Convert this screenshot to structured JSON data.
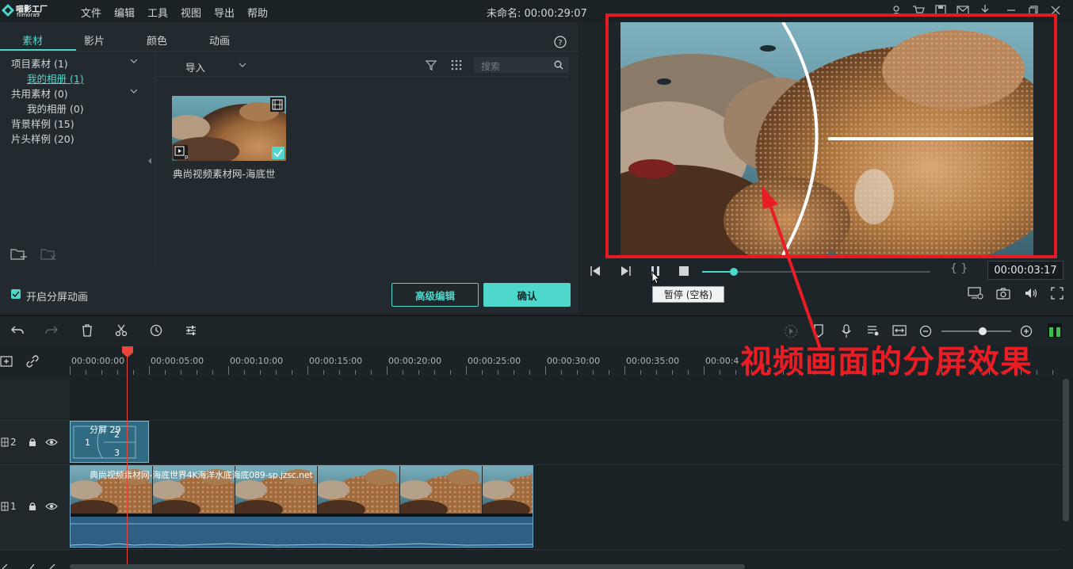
{
  "app": {
    "logo_cn": "喵影工厂",
    "logo_en": "filmora9",
    "project_title": "未命名: 00:00:29:07"
  },
  "menu": [
    "文件",
    "编辑",
    "工具",
    "视图",
    "导出",
    "帮助"
  ],
  "media": {
    "tabs": [
      "素材",
      "影片",
      "颜色",
      "动画"
    ],
    "tree": [
      "项目素材 (1)",
      "我的相册 (1)",
      "共用素材 (0)",
      "我的相册 (0)",
      "背景样例 (15)",
      "片头样例 (20)"
    ],
    "import_label": "导入",
    "search_placeholder": "搜索",
    "thumb_caption": "典尚视频素材网-海底世",
    "split_anim_label": "开启分屏动画",
    "advanced_button": "高级编辑",
    "confirm_button": "确认"
  },
  "preview": {
    "timecode": "00:00:03:17",
    "tooltip": "暂停 (空格)",
    "progress": 0.14
  },
  "timeline": {
    "ruler": [
      "00:00:00:00",
      "00:00:05:00",
      "00:00:10:00",
      "00:00:15:00",
      "00:00:20:00",
      "00:00:25:00",
      "00:00:30:00",
      "00:00:35:00",
      "00:00:4"
    ],
    "tracks": [
      {
        "number": "2"
      },
      {
        "number": "1"
      }
    ],
    "split_clip": {
      "title": "分屏 29",
      "n1": "1",
      "n2": "2",
      "n3": "3"
    },
    "video_clip_title": "典尚视频素材网-海底世界4K海洋水底海底089-sp.jzsc.net"
  },
  "annotation": "视频画面的分屏效果",
  "colors": {
    "accent": "#4ed8cc",
    "annotation": "#ea1c24",
    "playhead": "#e8453c"
  }
}
